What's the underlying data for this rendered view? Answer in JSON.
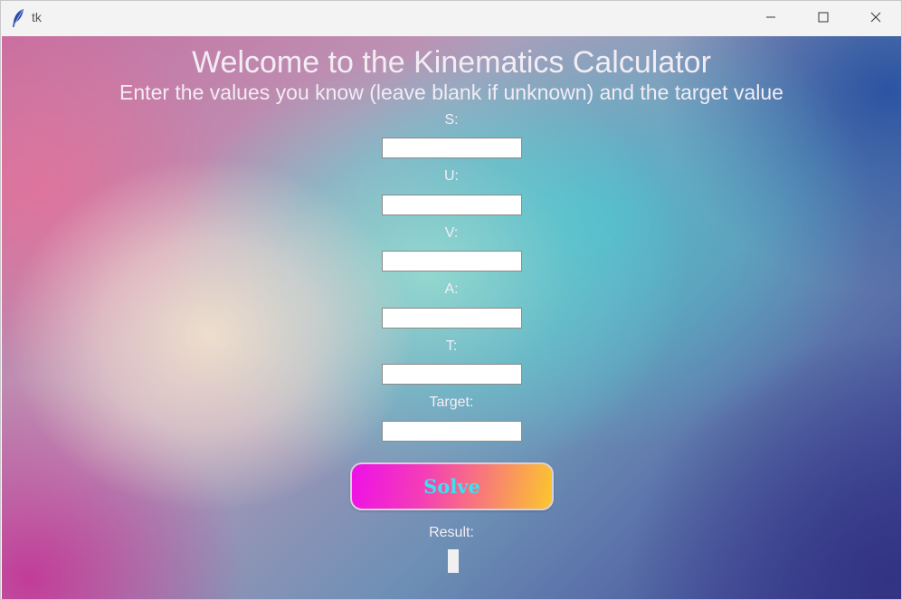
{
  "window": {
    "title": "tk"
  },
  "main": {
    "heading": "Welcome to the Kinematics Calculator",
    "subheading": "Enter the values you know (leave blank if unknown) and the target value",
    "fields": [
      {
        "label": "S:",
        "value": ""
      },
      {
        "label": "U:",
        "value": ""
      },
      {
        "label": "V:",
        "value": ""
      },
      {
        "label": "A:",
        "value": ""
      },
      {
        "label": "T:",
        "value": ""
      },
      {
        "label": "Target:",
        "value": ""
      }
    ],
    "solve_label": "Solve",
    "result_label": "Result:",
    "result_value": ""
  },
  "colors": {
    "solve_text": "#38e4f4",
    "solve_gradient_start": "#ee10e8",
    "solve_gradient_end": "#fbc72c",
    "label_text": "#f3eef5"
  },
  "icons": {
    "app": "feather-icon",
    "minimize": "minimize-icon",
    "maximize": "maximize-icon",
    "close": "close-icon"
  }
}
